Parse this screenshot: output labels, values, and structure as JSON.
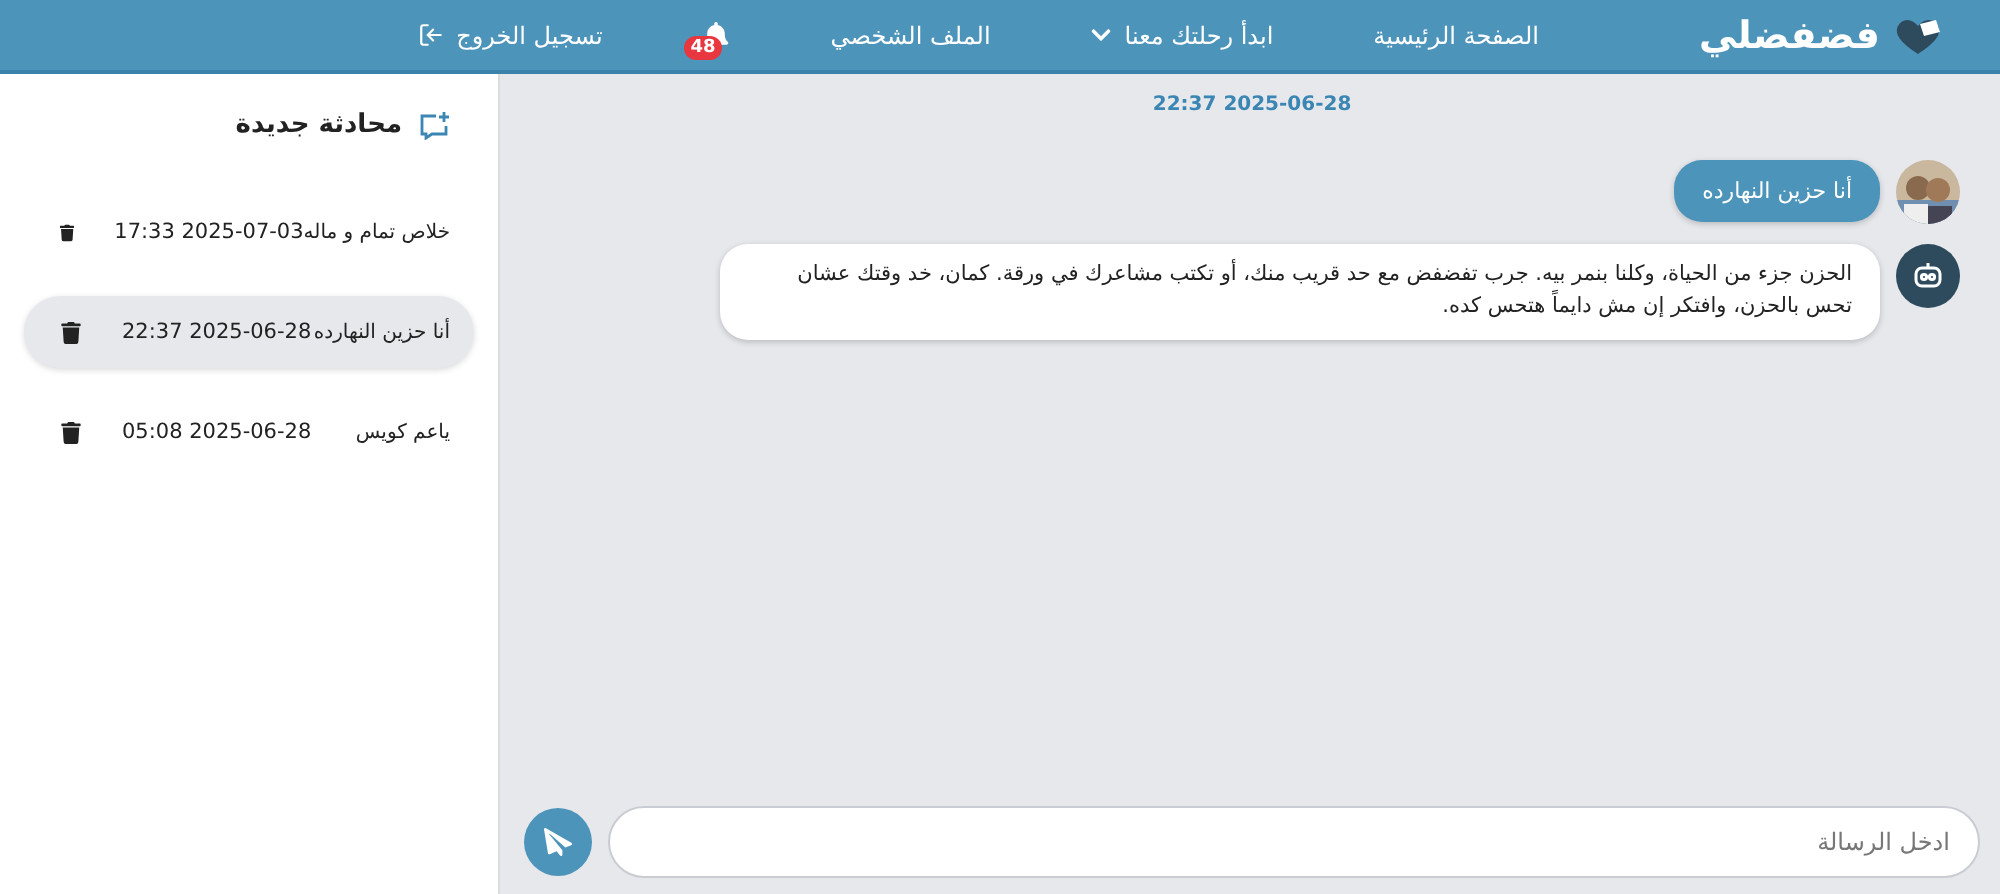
{
  "brand": {
    "name": "فضفضلي"
  },
  "nav": [
    {
      "kind": "link",
      "label": "الصفحة الرئيسية"
    },
    {
      "kind": "dropdown",
      "label": "ابدأ رحلتك معنا"
    },
    {
      "kind": "link",
      "label": "الملف الشخصي"
    },
    {
      "kind": "bell",
      "badge": "48"
    },
    {
      "kind": "logout",
      "label": "تسجيل الخروج"
    }
  ],
  "sidebar": {
    "new_chat": "محادثة جديدة",
    "conversations": [
      {
        "title": "خلاص تمام و ماله",
        "time": "2025-07-03 17:33",
        "selected": false
      },
      {
        "title": "أنا حزين النهارده",
        "time": "2025-06-28 22:37",
        "selected": true
      },
      {
        "title": "ياعم كويس",
        "time": "2025-06-28 05:08",
        "selected": false
      }
    ]
  },
  "chat": {
    "date": "2025-06-28 22:37",
    "messages": [
      {
        "kind": "user",
        "text": "أنا حزين النهارده"
      },
      {
        "kind": "bot",
        "text": "الحزن جزء من الحياة، وكلنا بنمر بيه. جرب تفضفض مع حد قريب منك، أو تكتب مشاعرك في ورقة. كمان، خد وقتك عشان تحس بالحزن، وافتكر إن مش دايماً هتحس كده."
      }
    ],
    "input": {
      "placeholder": "ادخل الرسالة"
    }
  }
}
